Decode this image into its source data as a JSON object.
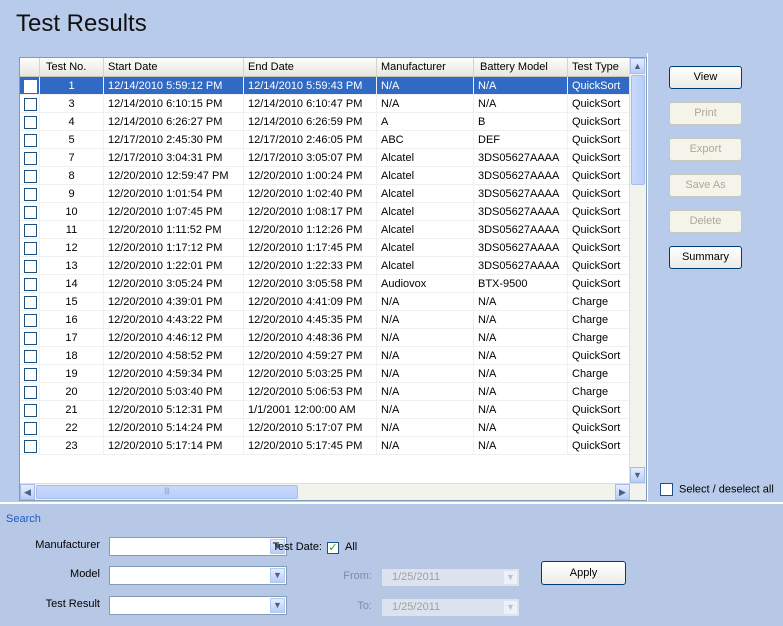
{
  "title": "Test Results",
  "grid": {
    "columns": [
      "",
      "Test No.",
      "Start Date",
      "End Date",
      "Manufacturer",
      "Battery Model",
      "Test Type"
    ],
    "rows": [
      {
        "no": "1",
        "start": "12/14/2010 5:59:12 PM",
        "end": "12/14/2010 5:59:43 PM",
        "mfr": "N/A",
        "model": "N/A",
        "type": "QuickSort",
        "selected": true
      },
      {
        "no": "3",
        "start": "12/14/2010 6:10:15 PM",
        "end": "12/14/2010 6:10:47 PM",
        "mfr": "N/A",
        "model": "N/A",
        "type": "QuickSort"
      },
      {
        "no": "4",
        "start": "12/14/2010 6:26:27 PM",
        "end": "12/14/2010 6:26:59 PM",
        "mfr": "A",
        "model": "B",
        "type": "QuickSort"
      },
      {
        "no": "5",
        "start": "12/17/2010 2:45:30 PM",
        "end": "12/17/2010 2:46:05 PM",
        "mfr": "ABC",
        "model": "DEF",
        "type": "QuickSort"
      },
      {
        "no": "7",
        "start": "12/17/2010 3:04:31 PM",
        "end": "12/17/2010 3:05:07 PM",
        "mfr": "Alcatel",
        "model": "3DS05627AAAA",
        "type": "QuickSort"
      },
      {
        "no": "8",
        "start": "12/20/2010 12:59:47 PM",
        "end": "12/20/2010 1:00:24 PM",
        "mfr": "Alcatel",
        "model": "3DS05627AAAA",
        "type": "QuickSort"
      },
      {
        "no": "9",
        "start": "12/20/2010 1:01:54 PM",
        "end": "12/20/2010 1:02:40 PM",
        "mfr": "Alcatel",
        "model": "3DS05627AAAA",
        "type": "QuickSort"
      },
      {
        "no": "10",
        "start": "12/20/2010 1:07:45 PM",
        "end": "12/20/2010 1:08:17 PM",
        "mfr": "Alcatel",
        "model": "3DS05627AAAA",
        "type": "QuickSort"
      },
      {
        "no": "11",
        "start": "12/20/2010 1:11:52 PM",
        "end": "12/20/2010 1:12:26 PM",
        "mfr": "Alcatel",
        "model": "3DS05627AAAA",
        "type": "QuickSort"
      },
      {
        "no": "12",
        "start": "12/20/2010 1:17:12 PM",
        "end": "12/20/2010 1:17:45 PM",
        "mfr": "Alcatel",
        "model": "3DS05627AAAA",
        "type": "QuickSort"
      },
      {
        "no": "13",
        "start": "12/20/2010 1:22:01 PM",
        "end": "12/20/2010 1:22:33 PM",
        "mfr": "Alcatel",
        "model": "3DS05627AAAA",
        "type": "QuickSort"
      },
      {
        "no": "14",
        "start": "12/20/2010 3:05:24 PM",
        "end": "12/20/2010 3:05:58 PM",
        "mfr": "Audiovox",
        "model": "BTX-9500",
        "type": "QuickSort"
      },
      {
        "no": "15",
        "start": "12/20/2010 4:39:01 PM",
        "end": "12/20/2010 4:41:09 PM",
        "mfr": "N/A",
        "model": "N/A",
        "type": "Charge"
      },
      {
        "no": "16",
        "start": "12/20/2010 4:43:22 PM",
        "end": "12/20/2010 4:45:35 PM",
        "mfr": "N/A",
        "model": "N/A",
        "type": "Charge"
      },
      {
        "no": "17",
        "start": "12/20/2010 4:46:12 PM",
        "end": "12/20/2010 4:48:36 PM",
        "mfr": "N/A",
        "model": "N/A",
        "type": "Charge"
      },
      {
        "no": "18",
        "start": "12/20/2010 4:58:52 PM",
        "end": "12/20/2010 4:59:27 PM",
        "mfr": "N/A",
        "model": "N/A",
        "type": "QuickSort"
      },
      {
        "no": "19",
        "start": "12/20/2010 4:59:34 PM",
        "end": "12/20/2010 5:03:25 PM",
        "mfr": "N/A",
        "model": "N/A",
        "type": "Charge"
      },
      {
        "no": "20",
        "start": "12/20/2010 5:03:40 PM",
        "end": "12/20/2010 5:06:53 PM",
        "mfr": "N/A",
        "model": "N/A",
        "type": "Charge"
      },
      {
        "no": "21",
        "start": "12/20/2010 5:12:31 PM",
        "end": "1/1/2001 12:00:00 AM",
        "mfr": "N/A",
        "model": "N/A",
        "type": "QuickSort"
      },
      {
        "no": "22",
        "start": "12/20/2010 5:14:24 PM",
        "end": "12/20/2010 5:17:07 PM",
        "mfr": "N/A",
        "model": "N/A",
        "type": "QuickSort"
      },
      {
        "no": "23",
        "start": "12/20/2010 5:17:14 PM",
        "end": "12/20/2010 5:17:45 PM",
        "mfr": "N/A",
        "model": "N/A",
        "type": "QuickSort"
      }
    ]
  },
  "actions": {
    "view": "View",
    "print": "Print",
    "export": "Export",
    "save_as": "Save As",
    "delete": "Delete",
    "summary": "Summary"
  },
  "select_all": "Select / deselect all",
  "search": {
    "legend": "Search",
    "manufacturer_label": "Manufacturer",
    "model_label": "Model",
    "test_result_label": "Test Result",
    "test_date_label": "Test Date:",
    "all_label": "All",
    "all_checked": true,
    "from_label": "From:",
    "to_label": "To:",
    "from_value": "1/25/2011",
    "to_value": "1/25/2011",
    "apply": "Apply"
  },
  "colors": {
    "background": "#b9cbea",
    "selection": "#316ac5",
    "legend": "#1f58c4"
  },
  "icons": {
    "scroll_up": "▲",
    "scroll_down": "▼",
    "scroll_left": "◀",
    "scroll_right": "▶",
    "dropdown": "▼",
    "check": "✓"
  }
}
